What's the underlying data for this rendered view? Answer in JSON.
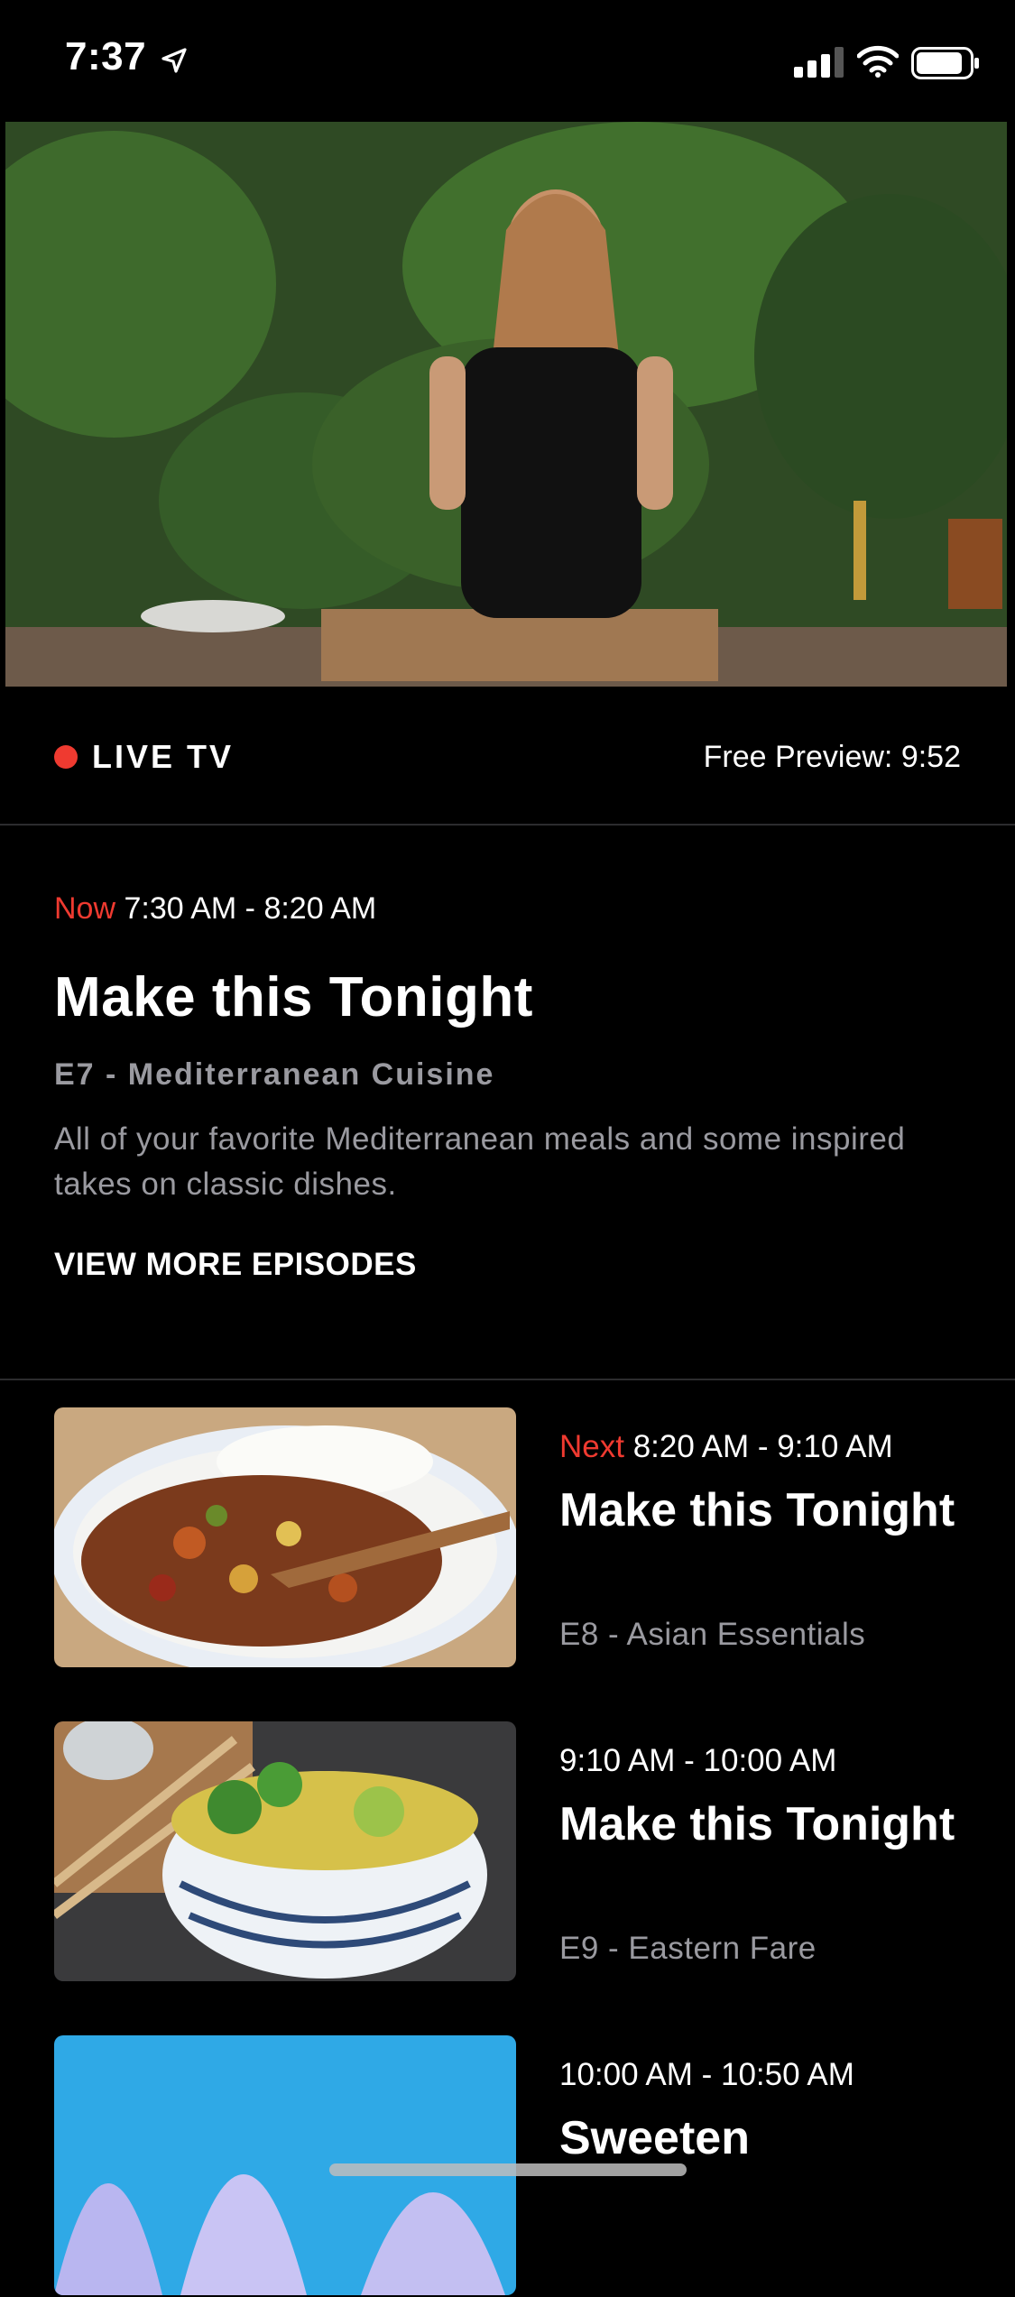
{
  "status_bar": {
    "time": "7:37"
  },
  "live": {
    "label": "LIVE TV",
    "free_preview": "Free Preview: 9:52"
  },
  "now": {
    "prefix": "Now",
    "time_range": "7:30 AM - 8:20 AM",
    "title": "Make this Tonight",
    "episode": "E7 - Mediterranean Cuisine",
    "description": "All of your favorite Mediterranean meals and some inspired takes on classic dishes.",
    "view_more": "VIEW MORE EPISODES"
  },
  "schedule": [
    {
      "prefix": "Next",
      "time_range": "8:20 AM - 9:10 AM",
      "title": "Make this Tonight",
      "episode": "E8 - Asian Essentials"
    },
    {
      "prefix": "",
      "time_range": "9:10 AM - 10:00 AM",
      "title": "Make this Tonight",
      "episode": "E9 - Eastern Fare"
    },
    {
      "prefix": "",
      "time_range": "10:00 AM - 10:50 AM",
      "title": "Sweeten",
      "episode": ""
    }
  ],
  "colors": {
    "accent_red": "#ef3a30",
    "secondary_text": "#9a9aa0",
    "background": "#000000"
  },
  "icons": [
    "location-arrow-icon",
    "cellular-signal-icon",
    "wifi-icon",
    "battery-icon"
  ]
}
